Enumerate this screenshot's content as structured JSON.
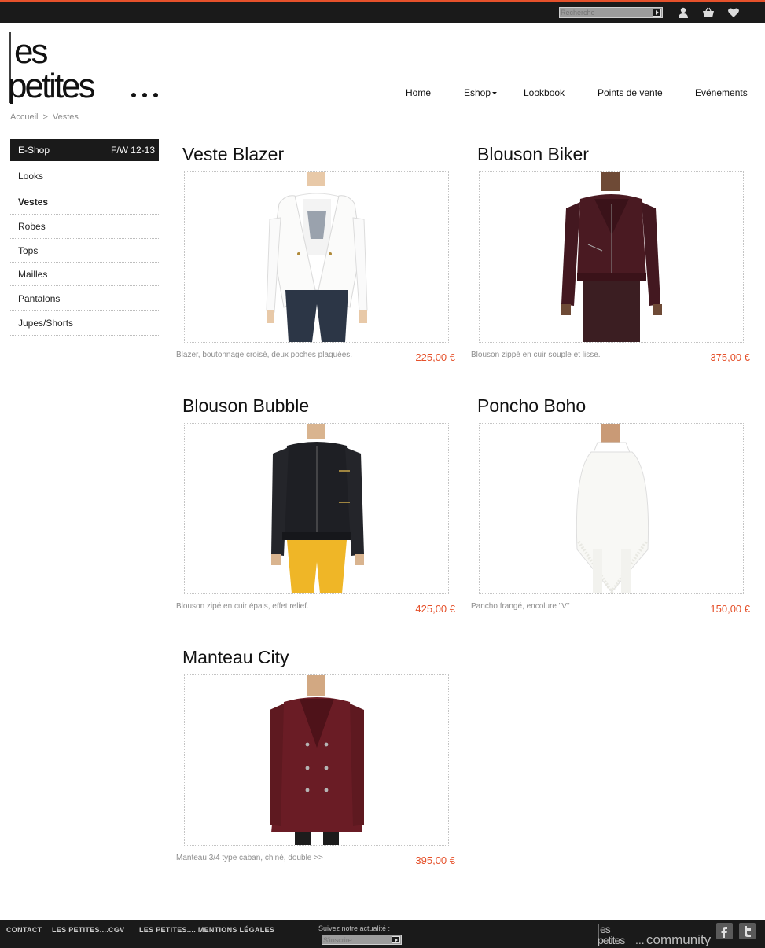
{
  "brand": {
    "logo_alt": "les petites...",
    "community_logo_alt": "les petites... community"
  },
  "topbar": {
    "search_placeholder": "Recherche"
  },
  "nav": {
    "home": "Home",
    "eshop": "Eshop",
    "lookbook": "Lookbook",
    "points_de_vente": "Points de vente",
    "evenements": "Evénements"
  },
  "breadcrumb": {
    "home": "Accueil",
    "separator": ">",
    "current": "Vestes"
  },
  "sidebar": {
    "header_left": "E-Shop",
    "header_right": "F/W 12-13",
    "items": [
      {
        "label": "Looks"
      },
      {
        "label": "Vestes"
      },
      {
        "label": "Robes"
      },
      {
        "label": "Tops"
      },
      {
        "label": "Mailles"
      },
      {
        "label": "Pantalons"
      },
      {
        "label": "Jupes/Shorts"
      }
    ]
  },
  "products": [
    {
      "title": "Veste Blazer",
      "description": "Blazer, boutonnage croisé, deux poches plaquées.",
      "price": "225,00 €"
    },
    {
      "title": "Blouson Biker",
      "description": "Blouson zippé en cuir souple et lisse.",
      "price": "375,00 €"
    },
    {
      "title": "Blouson Bubble",
      "description": "Blouson zipé en cuir épais, effet relief.",
      "price": "425,00 €"
    },
    {
      "title": "Poncho Boho",
      "description": "Pancho frangé, encolure \"V\"",
      "price": "150,00 €"
    },
    {
      "title": "Manteau City",
      "description": "Manteau 3/4 type caban, chiné, double >>",
      "price": "395,00 €"
    }
  ],
  "footer": {
    "contact": "CONTACT",
    "cgv": "LES PETITES....CGV",
    "mentions": "LES PETITES.... MENTIONS LÉGALES",
    "follow_label": "Suivez notre actualité :",
    "subscribe_placeholder": "S'inscrire"
  },
  "colors": {
    "accent": "#e5512b",
    "dark": "#1a1a1a",
    "text_muted": "#8d8d8d"
  }
}
